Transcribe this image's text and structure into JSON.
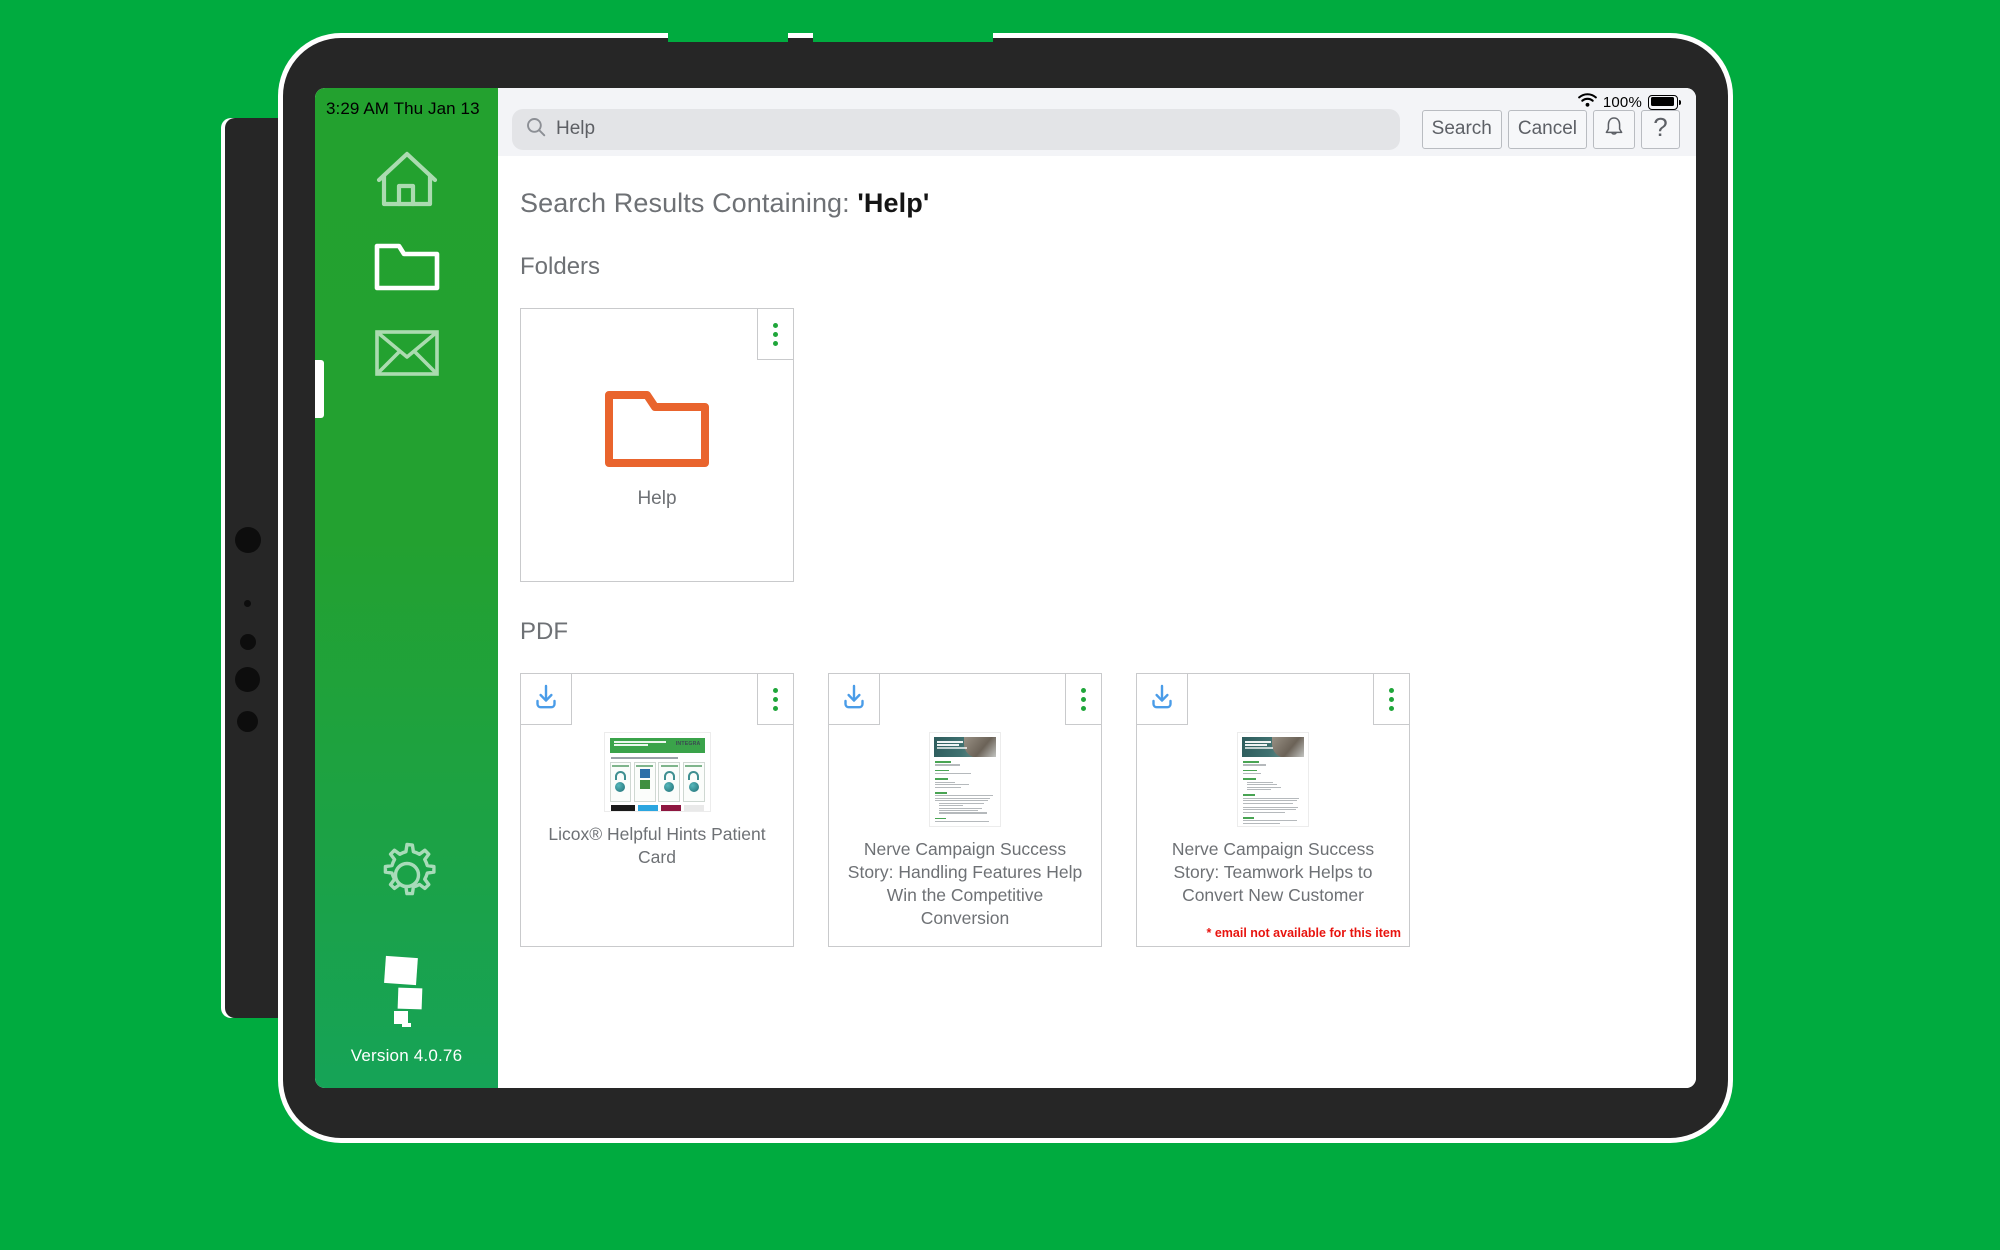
{
  "device": {
    "status_bar": {
      "time_date": "3:29 AM   Thu Jan 13",
      "battery_percent": "100%"
    }
  },
  "sidebar": {
    "items": [
      {
        "name": "home",
        "icon": "home-icon",
        "active": false
      },
      {
        "name": "folders",
        "icon": "folder-icon",
        "active": true
      },
      {
        "name": "mail",
        "icon": "envelope-icon",
        "active": false
      },
      {
        "name": "settings",
        "icon": "gear-icon",
        "active": false
      }
    ],
    "version_label": "Version 4.0.76"
  },
  "toolbar": {
    "search_value": "Help",
    "search_placeholder": "Help",
    "search_button": "Search",
    "cancel_button": "Cancel",
    "notifications_icon": "bell-icon",
    "help_button": "?"
  },
  "main": {
    "results_heading_prefix": "Search Results Containing: ",
    "results_query": "'Help'",
    "sections": [
      {
        "label": "Folders",
        "items": [
          {
            "title": "Help",
            "icon": "folder-icon",
            "accent": "#e9642d",
            "downloadable": false,
            "note": ""
          }
        ]
      },
      {
        "label": "PDF",
        "items": [
          {
            "title": "Licox® Helpful Hints Patient Card",
            "thumb": "landscape-product-card",
            "downloadable": true,
            "note": ""
          },
          {
            "title": "Nerve Campaign Success Story: Handling Features Help Win the Competitive Conversion",
            "thumb": "portrait-success-story",
            "downloadable": true,
            "note": ""
          },
          {
            "title": "Nerve Campaign Success Story: Teamwork Helps to Convert New Customer",
            "thumb": "portrait-success-story",
            "downloadable": true,
            "note": "* email not available for this item"
          }
        ]
      }
    ]
  },
  "colors": {
    "brand_green": "#00ab3f",
    "sidebar_green_top": "#23a12f",
    "sidebar_green_bottom": "#16a357",
    "folder_orange": "#e9642d",
    "kebab_green": "#1fa63a",
    "download_blue": "#4a9ce8",
    "note_red": "#e8140f"
  }
}
